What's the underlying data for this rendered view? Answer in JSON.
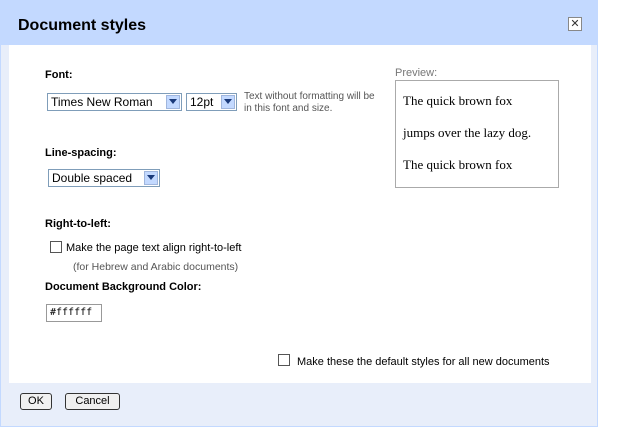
{
  "dialog": {
    "title": "Document styles",
    "close_glyph": "✕"
  },
  "font": {
    "label": "Font:",
    "family_value": "Times New Roman",
    "size_value": "12pt",
    "hint": "Text without formatting will be in this font and size."
  },
  "spacing": {
    "label": "Line-spacing:",
    "value": "Double spaced"
  },
  "rtl": {
    "label": "Right-to-left:",
    "checkbox_label": "Make the page text align right-to-left",
    "note": "(for Hebrew and Arabic documents)",
    "checked": false
  },
  "bg": {
    "label": "Document Background Color:",
    "value": "#ffffff"
  },
  "preview": {
    "label": "Preview:",
    "lines": [
      "The quick brown fox",
      "jumps over the lazy dog.",
      "The quick brown fox"
    ]
  },
  "defaults": {
    "checkbox_label": "Make these the default styles for all new documents",
    "checked": false
  },
  "buttons": {
    "ok": "OK",
    "cancel": "Cancel"
  },
  "colors": {
    "titlebar": "#c3d9ff",
    "frame": "#e8eefa"
  },
  "icons": {
    "close": "close-icon",
    "dropdown": "chevron-down-icon"
  }
}
